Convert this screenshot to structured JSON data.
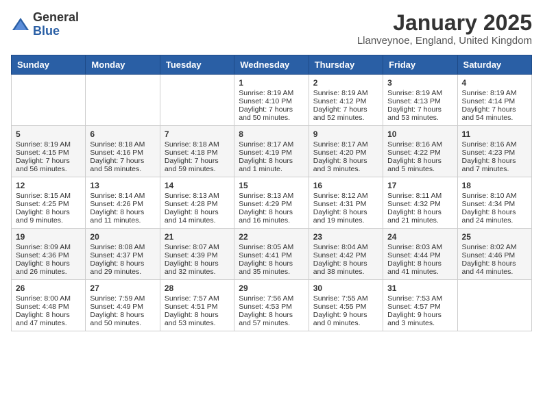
{
  "header": {
    "logo_general": "General",
    "logo_blue": "Blue",
    "title": "January 2025",
    "subtitle": "Llanveynoe, England, United Kingdom"
  },
  "days_of_week": [
    "Sunday",
    "Monday",
    "Tuesday",
    "Wednesday",
    "Thursday",
    "Friday",
    "Saturday"
  ],
  "weeks": [
    [
      {
        "day": "",
        "sunrise": "",
        "sunset": "",
        "daylight": ""
      },
      {
        "day": "",
        "sunrise": "",
        "sunset": "",
        "daylight": ""
      },
      {
        "day": "",
        "sunrise": "",
        "sunset": "",
        "daylight": ""
      },
      {
        "day": "1",
        "sunrise": "Sunrise: 8:19 AM",
        "sunset": "Sunset: 4:10 PM",
        "daylight": "Daylight: 7 hours and 50 minutes."
      },
      {
        "day": "2",
        "sunrise": "Sunrise: 8:19 AM",
        "sunset": "Sunset: 4:12 PM",
        "daylight": "Daylight: 7 hours and 52 minutes."
      },
      {
        "day": "3",
        "sunrise": "Sunrise: 8:19 AM",
        "sunset": "Sunset: 4:13 PM",
        "daylight": "Daylight: 7 hours and 53 minutes."
      },
      {
        "day": "4",
        "sunrise": "Sunrise: 8:19 AM",
        "sunset": "Sunset: 4:14 PM",
        "daylight": "Daylight: 7 hours and 54 minutes."
      }
    ],
    [
      {
        "day": "5",
        "sunrise": "Sunrise: 8:19 AM",
        "sunset": "Sunset: 4:15 PM",
        "daylight": "Daylight: 7 hours and 56 minutes."
      },
      {
        "day": "6",
        "sunrise": "Sunrise: 8:18 AM",
        "sunset": "Sunset: 4:16 PM",
        "daylight": "Daylight: 7 hours and 58 minutes."
      },
      {
        "day": "7",
        "sunrise": "Sunrise: 8:18 AM",
        "sunset": "Sunset: 4:18 PM",
        "daylight": "Daylight: 7 hours and 59 minutes."
      },
      {
        "day": "8",
        "sunrise": "Sunrise: 8:17 AM",
        "sunset": "Sunset: 4:19 PM",
        "daylight": "Daylight: 8 hours and 1 minute."
      },
      {
        "day": "9",
        "sunrise": "Sunrise: 8:17 AM",
        "sunset": "Sunset: 4:20 PM",
        "daylight": "Daylight: 8 hours and 3 minutes."
      },
      {
        "day": "10",
        "sunrise": "Sunrise: 8:16 AM",
        "sunset": "Sunset: 4:22 PM",
        "daylight": "Daylight: 8 hours and 5 minutes."
      },
      {
        "day": "11",
        "sunrise": "Sunrise: 8:16 AM",
        "sunset": "Sunset: 4:23 PM",
        "daylight": "Daylight: 8 hours and 7 minutes."
      }
    ],
    [
      {
        "day": "12",
        "sunrise": "Sunrise: 8:15 AM",
        "sunset": "Sunset: 4:25 PM",
        "daylight": "Daylight: 8 hours and 9 minutes."
      },
      {
        "day": "13",
        "sunrise": "Sunrise: 8:14 AM",
        "sunset": "Sunset: 4:26 PM",
        "daylight": "Daylight: 8 hours and 11 minutes."
      },
      {
        "day": "14",
        "sunrise": "Sunrise: 8:13 AM",
        "sunset": "Sunset: 4:28 PM",
        "daylight": "Daylight: 8 hours and 14 minutes."
      },
      {
        "day": "15",
        "sunrise": "Sunrise: 8:13 AM",
        "sunset": "Sunset: 4:29 PM",
        "daylight": "Daylight: 8 hours and 16 minutes."
      },
      {
        "day": "16",
        "sunrise": "Sunrise: 8:12 AM",
        "sunset": "Sunset: 4:31 PM",
        "daylight": "Daylight: 8 hours and 19 minutes."
      },
      {
        "day": "17",
        "sunrise": "Sunrise: 8:11 AM",
        "sunset": "Sunset: 4:32 PM",
        "daylight": "Daylight: 8 hours and 21 minutes."
      },
      {
        "day": "18",
        "sunrise": "Sunrise: 8:10 AM",
        "sunset": "Sunset: 4:34 PM",
        "daylight": "Daylight: 8 hours and 24 minutes."
      }
    ],
    [
      {
        "day": "19",
        "sunrise": "Sunrise: 8:09 AM",
        "sunset": "Sunset: 4:36 PM",
        "daylight": "Daylight: 8 hours and 26 minutes."
      },
      {
        "day": "20",
        "sunrise": "Sunrise: 8:08 AM",
        "sunset": "Sunset: 4:37 PM",
        "daylight": "Daylight: 8 hours and 29 minutes."
      },
      {
        "day": "21",
        "sunrise": "Sunrise: 8:07 AM",
        "sunset": "Sunset: 4:39 PM",
        "daylight": "Daylight: 8 hours and 32 minutes."
      },
      {
        "day": "22",
        "sunrise": "Sunrise: 8:05 AM",
        "sunset": "Sunset: 4:41 PM",
        "daylight": "Daylight: 8 hours and 35 minutes."
      },
      {
        "day": "23",
        "sunrise": "Sunrise: 8:04 AM",
        "sunset": "Sunset: 4:42 PM",
        "daylight": "Daylight: 8 hours and 38 minutes."
      },
      {
        "day": "24",
        "sunrise": "Sunrise: 8:03 AM",
        "sunset": "Sunset: 4:44 PM",
        "daylight": "Daylight: 8 hours and 41 minutes."
      },
      {
        "day": "25",
        "sunrise": "Sunrise: 8:02 AM",
        "sunset": "Sunset: 4:46 PM",
        "daylight": "Daylight: 8 hours and 44 minutes."
      }
    ],
    [
      {
        "day": "26",
        "sunrise": "Sunrise: 8:00 AM",
        "sunset": "Sunset: 4:48 PM",
        "daylight": "Daylight: 8 hours and 47 minutes."
      },
      {
        "day": "27",
        "sunrise": "Sunrise: 7:59 AM",
        "sunset": "Sunset: 4:49 PM",
        "daylight": "Daylight: 8 hours and 50 minutes."
      },
      {
        "day": "28",
        "sunrise": "Sunrise: 7:57 AM",
        "sunset": "Sunset: 4:51 PM",
        "daylight": "Daylight: 8 hours and 53 minutes."
      },
      {
        "day": "29",
        "sunrise": "Sunrise: 7:56 AM",
        "sunset": "Sunset: 4:53 PM",
        "daylight": "Daylight: 8 hours and 57 minutes."
      },
      {
        "day": "30",
        "sunrise": "Sunrise: 7:55 AM",
        "sunset": "Sunset: 4:55 PM",
        "daylight": "Daylight: 9 hours and 0 minutes."
      },
      {
        "day": "31",
        "sunrise": "Sunrise: 7:53 AM",
        "sunset": "Sunset: 4:57 PM",
        "daylight": "Daylight: 9 hours and 3 minutes."
      },
      {
        "day": "",
        "sunrise": "",
        "sunset": "",
        "daylight": ""
      }
    ]
  ]
}
